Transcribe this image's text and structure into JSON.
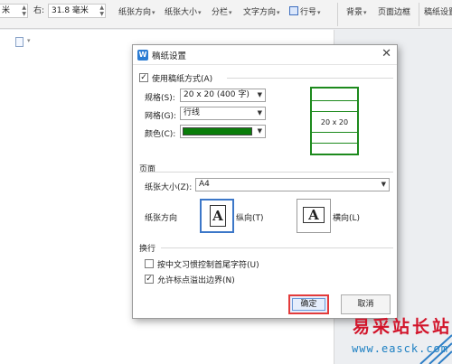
{
  "ribbon": {
    "left_value": "米",
    "right_label": "右:",
    "right_value": "31.8 毫米",
    "paper_direction": "纸张方向",
    "paper_size": "纸张大小",
    "columns": "分栏",
    "text_direction": "文字方向",
    "line_number": "行号",
    "background": "背景",
    "page_border": "页面边框",
    "grid_paper": "稿纸设置"
  },
  "dialog": {
    "title": "稿纸设置",
    "use_grid_label": "使用稿纸方式(A)",
    "use_grid_checked": true,
    "spec_label": "规格(S):",
    "spec_value": "20 x 20 (400 字)",
    "grid_label": "网格(G):",
    "grid_value": "行线",
    "color_label": "颜色(C):",
    "color_value": "#0a7d0a",
    "preview_text": "20 x 20",
    "page_section": "页面",
    "paper_size_label": "纸张大小(Z):",
    "paper_size_value": "A4",
    "orientation_label": "纸张方向",
    "portrait_label": "纵向(T)",
    "landscape_label": "横向(L)",
    "portrait_selected": true,
    "wrap_section": "换行",
    "opt1_label": "按中文习惯控制首尾字符(U)",
    "opt1_checked": false,
    "opt2_label": "允许标点溢出边界(N)",
    "opt2_checked": true,
    "ok_label": "确定",
    "cancel_label": "取消"
  },
  "watermark": {
    "title": "易采站长站",
    "url": "www.easck.com"
  }
}
